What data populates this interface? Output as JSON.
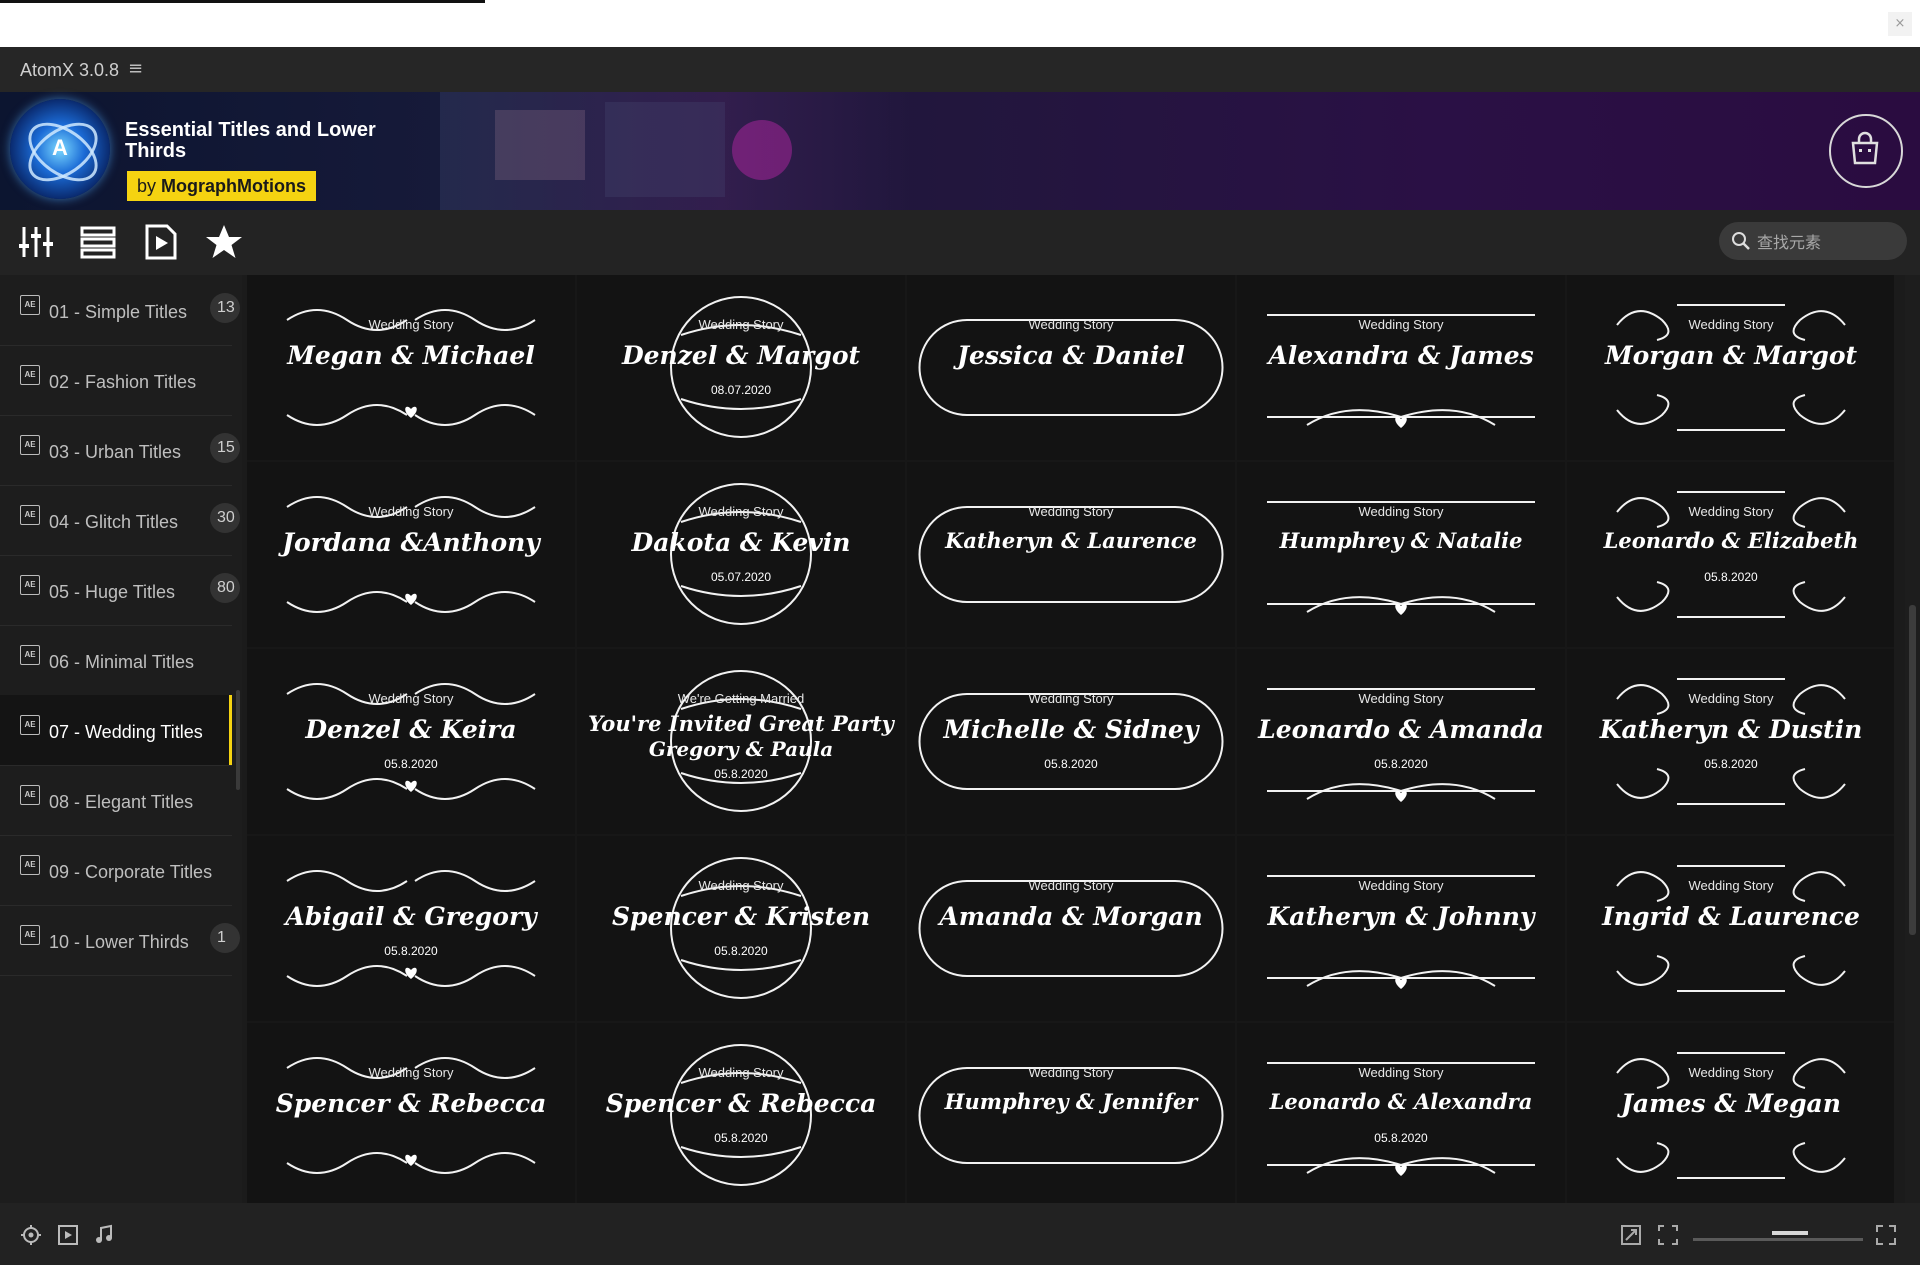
{
  "app": {
    "name": "AtomX 3.0.8",
    "close_glyph": "×"
  },
  "banner": {
    "title": "Essential Titles and Lower Thirds",
    "by": "by",
    "author": "MographMotions",
    "accent": "#f5d311"
  },
  "search": {
    "placeholder": "查找元素"
  },
  "toolbar": {
    "icons": [
      "sliders-icon",
      "list-icon",
      "media-icon",
      "star-icon"
    ]
  },
  "sidebar": {
    "items": [
      {
        "label": "01 - Simple Titles",
        "count": "13"
      },
      {
        "label": "02 - Fashion Titles",
        "count": ""
      },
      {
        "label": "03 - Urban Titles",
        "count": "15"
      },
      {
        "label": "04 - Glitch Titles",
        "count": "30"
      },
      {
        "label": "05 - Huge Titles",
        "count": "80"
      },
      {
        "label": "06 - Minimal Titles",
        "count": ""
      },
      {
        "label": "07 - Wedding Titles",
        "count": "",
        "active": true
      },
      {
        "label": "08 - Elegant Titles",
        "count": ""
      },
      {
        "label": "09 - Corporate Titles",
        "count": ""
      },
      {
        "label": "10 - Lower Thirds",
        "count": "1"
      }
    ]
  },
  "tiles": [
    {
      "small": "Wedding Story",
      "names": "Megan & Michael",
      "date": ""
    },
    {
      "small": "Wedding Story",
      "names": "Denzel & Margot",
      "date": "08.07.2020"
    },
    {
      "small": "Wedding Story",
      "names": "Jessica & Daniel",
      "date": ""
    },
    {
      "small": "Wedding Story",
      "names": "Alexandra & James",
      "date": ""
    },
    {
      "small": "Wedding Story",
      "names": "Morgan & Margot",
      "date": ""
    },
    {
      "small": "Wedding Story",
      "names": "Jordana &Anthony",
      "date": ""
    },
    {
      "small": "Wedding Story",
      "names": "Dakota & Kevin",
      "date": "05.07.2020"
    },
    {
      "small": "Wedding Story",
      "names": "Katheryn & Laurence",
      "date": ""
    },
    {
      "small": "Wedding Story",
      "names": "Humphrey & Natalie",
      "date": ""
    },
    {
      "small": "Wedding Story",
      "names": "Leonardo & Elizabeth",
      "date": "05.8.2020"
    },
    {
      "small": "Wedding Story",
      "names": "Denzel & Keira",
      "date": "05.8.2020"
    },
    {
      "small": "We're Getting Married",
      "names": "You're Invited Great Party",
      "names2": "Gregory & Paula",
      "date": "05.8.2020"
    },
    {
      "small": "Wedding Story",
      "names": "Michelle & Sidney",
      "date": "05.8.2020"
    },
    {
      "small": "Wedding Story",
      "names": "Leonardo & Amanda",
      "date": "05.8.2020"
    },
    {
      "small": "Wedding Story",
      "names": "Katheryn & Dustin",
      "date": "05.8.2020"
    },
    {
      "small": "",
      "names": "Abigail & Gregory",
      "date": "05.8.2020"
    },
    {
      "small": "Wedding Story",
      "names": "Spencer & Kristen",
      "date": "05.8.2020"
    },
    {
      "small": "Wedding Story",
      "names": "Amanda & Morgan",
      "date": ""
    },
    {
      "small": "Wedding Story",
      "names": "Katheryn & Johnny",
      "date": ""
    },
    {
      "small": "Wedding Story",
      "names": "Ingrid & Laurence",
      "date": ""
    },
    {
      "small": "Wedding Story",
      "names": "Spencer & Rebecca",
      "date": ""
    },
    {
      "small": "Wedding Story",
      "names": "Spencer & Rebecca",
      "date": "05.8.2020"
    },
    {
      "small": "Wedding Story",
      "names": "Humphrey & Jennifer",
      "date": ""
    },
    {
      "small": "Wedding Story",
      "names": "Leonardo & Alexandra",
      "date": "05.8.2020"
    },
    {
      "small": "Wedding Story",
      "names": "James & Megan",
      "date": ""
    }
  ]
}
